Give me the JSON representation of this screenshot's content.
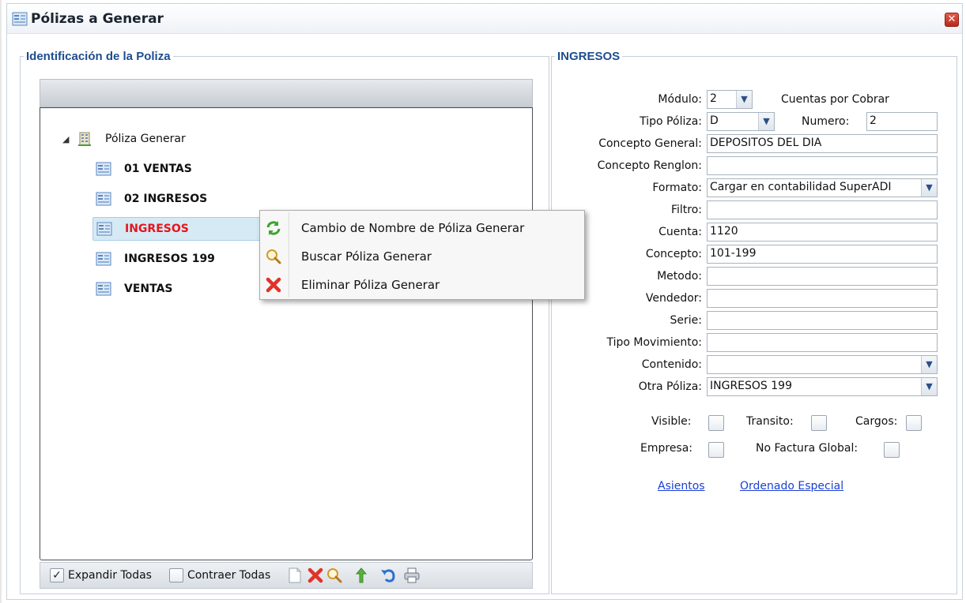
{
  "window": {
    "title": "Pólizas a Generar"
  },
  "left_panel": {
    "legend": "Identificación de la Poliza",
    "tree": {
      "root_label": "Póliza Generar",
      "nodes": [
        {
          "label": "01 VENTAS"
        },
        {
          "label": "02 INGRESOS"
        },
        {
          "label": "INGRESOS",
          "selected": true
        },
        {
          "label": "INGRESOS 199"
        },
        {
          "label": "VENTAS"
        }
      ]
    },
    "toolbar": {
      "expand_label": "Expandir Todas",
      "expand_checked": "✓",
      "collapse_label": "Contraer Todas"
    }
  },
  "context_menu": {
    "items": [
      {
        "label": "Cambio de Nombre de Póliza Generar",
        "icon": "refresh-icon"
      },
      {
        "label": "Buscar Póliza Generar",
        "icon": "search-icon"
      },
      {
        "label": "Eliminar Póliza Generar",
        "icon": "delete-icon"
      }
    ]
  },
  "right_panel": {
    "legend": "INGRESOS",
    "modulo": {
      "label": "Módulo:",
      "value": "2",
      "desc": "Cuentas por Cobrar"
    },
    "tipo_poliza": {
      "label": "Tipo Póliza:",
      "value": "D"
    },
    "numero": {
      "label": "Numero:",
      "value": "2"
    },
    "concepto_general": {
      "label": "Concepto General:",
      "value": "DEPOSITOS DEL DIA"
    },
    "concepto_renglon": {
      "label": "Concepto Renglon:",
      "value": ""
    },
    "formato": {
      "label": "Formato:",
      "value": "Cargar en contabilidad SuperADI"
    },
    "filtro": {
      "label": "Filtro:",
      "value": ""
    },
    "cuenta": {
      "label": "Cuenta:",
      "value": "1120"
    },
    "concepto": {
      "label": "Concepto:",
      "value": "101-199"
    },
    "metodo": {
      "label": "Metodo:",
      "value": ""
    },
    "vendedor": {
      "label": "Vendedor:",
      "value": ""
    },
    "serie": {
      "label": "Serie:",
      "value": ""
    },
    "tipo_movimiento": {
      "label": "Tipo Movimiento:",
      "value": ""
    },
    "contenido": {
      "label": "Contenido:",
      "value": ""
    },
    "otra_poliza": {
      "label": "Otra Póliza:",
      "value": "INGRESOS 199"
    },
    "checks": {
      "visible": "Visible:",
      "transito": "Transito:",
      "cargos": "Cargos:",
      "empresa": "Empresa:",
      "no_factura_global": "No Factura Global:"
    },
    "links": {
      "asientos": "Asientos",
      "ordenado_especial": "Ordenado Especial"
    }
  },
  "colors": {
    "legend": "#1d4d8f",
    "selected_text": "#e8141b",
    "link": "#1a3fd6"
  }
}
